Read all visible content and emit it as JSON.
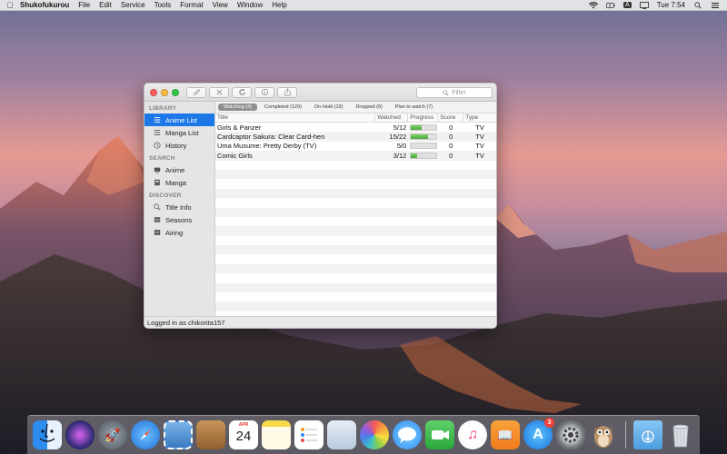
{
  "menubar": {
    "app_name": "Shukofukurou",
    "menus": [
      "File",
      "Edit",
      "Service",
      "Tools",
      "Format",
      "View",
      "Window",
      "Help"
    ],
    "clock": "Tue 7:54",
    "input_source": "A"
  },
  "window": {
    "filter_placeholder": "Filter",
    "sidebar": {
      "library_heading": "LIBRARY",
      "library_items": [
        "Anime List",
        "Manga List",
        "History"
      ],
      "search_heading": "SEARCH",
      "search_items": [
        "Anime",
        "Manga"
      ],
      "discover_heading": "DISCOVER",
      "discover_items": [
        "Title Info",
        "Seasons",
        "Airing"
      ],
      "active_item": "Anime List"
    },
    "tabs": [
      "Watching (4)",
      "Completed (129)",
      "On Hold (19)",
      "Dropped (9)",
      "Plan to watch (7)"
    ],
    "active_tab": "Watching (4)",
    "columns": [
      "Title",
      "Watched",
      "Progress",
      "Score",
      "Type"
    ],
    "rows": [
      {
        "title": "Girls & Panzer",
        "watched": "5/12",
        "progress": 0.42,
        "score": "0",
        "type": "TV"
      },
      {
        "title": "Cardcaptor Sakura: Clear Card-hen",
        "watched": "15/22",
        "progress": 0.68,
        "score": "0",
        "type": "TV"
      },
      {
        "title": "Uma Musume: Pretty Derby (TV)",
        "watched": "5/0",
        "progress": 0.0,
        "score": "0",
        "type": "TV"
      },
      {
        "title": "Comic Girls",
        "watched": "3/12",
        "progress": 0.25,
        "score": "0",
        "type": "TV"
      }
    ],
    "status": "Logged in as chikorita157"
  },
  "dock": {
    "calendar_month": "APR",
    "calendar_day": "24",
    "appstore_badge": "3"
  },
  "colors": {
    "accent": "#1c78e6",
    "progress_fill": "#4ea83c"
  }
}
